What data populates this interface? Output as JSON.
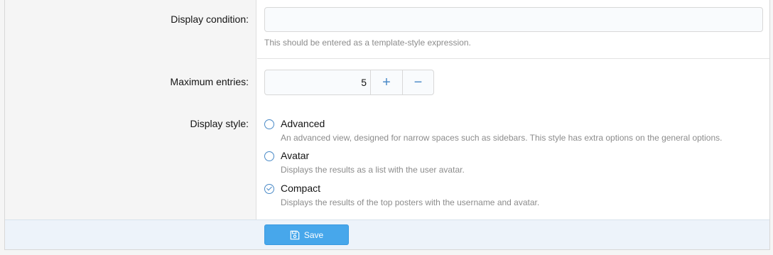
{
  "form": {
    "display_condition": {
      "label": "Display condition:",
      "value": "",
      "hint": "This should be entered as a template-style expression."
    },
    "maximum_entries": {
      "label": "Maximum entries:",
      "value": "5",
      "increment_symbol": "+",
      "decrement_symbol": "−"
    },
    "display_style": {
      "label": "Display style:",
      "selected": "Compact",
      "options": [
        {
          "label": "Advanced",
          "description": "An advanced view, designed for narrow spaces such as sidebars. This style has extra options on the general options."
        },
        {
          "label": "Avatar",
          "description": "Displays the results as a list with the user avatar."
        },
        {
          "label": "Compact",
          "description": "Displays the results of the top posters with the username and avatar."
        }
      ]
    }
  },
  "footer": {
    "save_label": "Save",
    "save_icon": "floppy-disk-icon"
  },
  "colors": {
    "accent": "#4a8ac7",
    "button": "#47a7eb",
    "footer_bg": "#edf3fa"
  }
}
